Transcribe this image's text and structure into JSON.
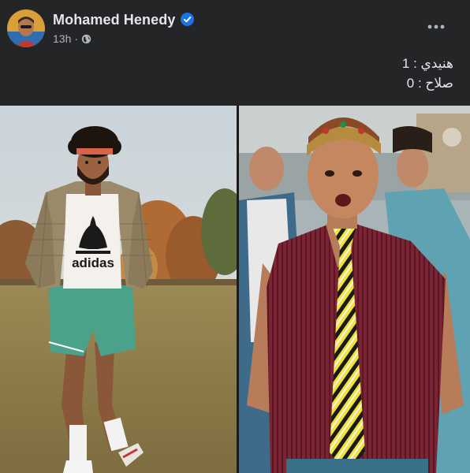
{
  "post": {
    "author": "Mohamed Henedy",
    "time": "13h",
    "separator": "·",
    "text_lines": [
      "هنيدي : 1",
      "صلاح : 0"
    ]
  },
  "icons": {
    "verified": "verified-badge-icon",
    "privacy": "globe-icon",
    "more": "more-options-icon"
  },
  "image": {
    "left_shirt_text": "adidas"
  },
  "colors": {
    "background": "#242526",
    "text_primary": "#e4e6eb",
    "text_secondary": "#b0b3b8",
    "verified": "#1b74e4"
  }
}
